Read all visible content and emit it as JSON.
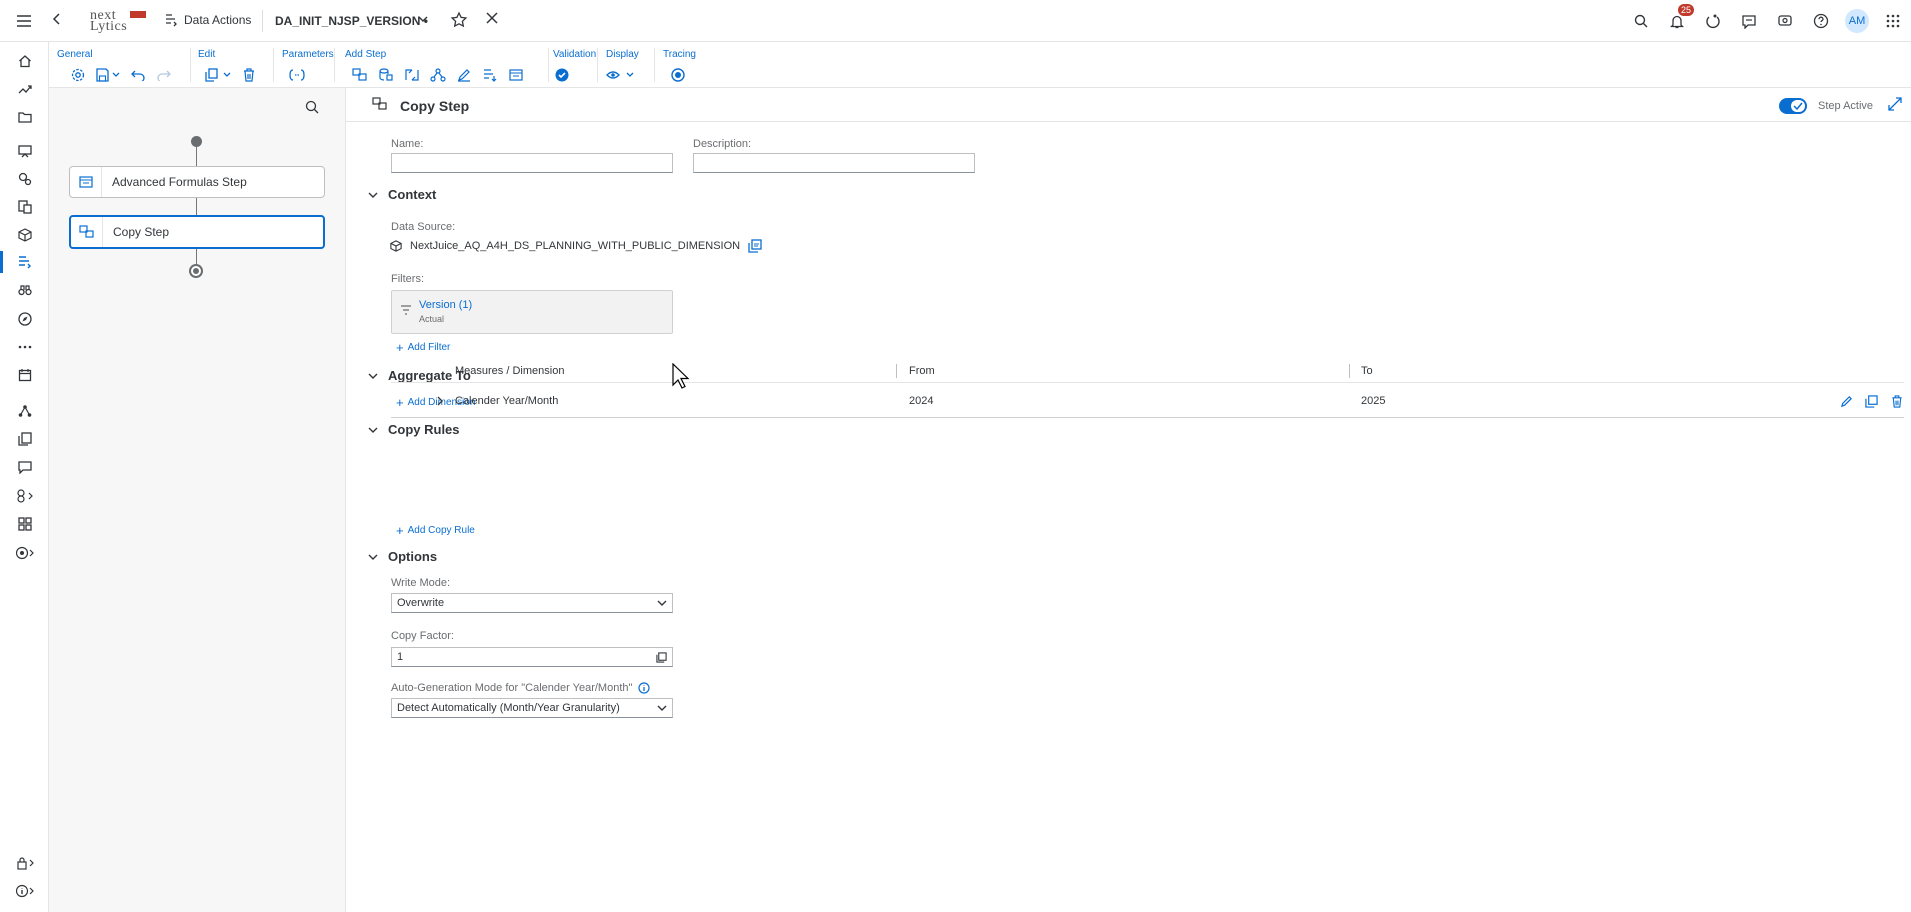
{
  "shell": {
    "logo_line1": "next",
    "logo_line2": "Lytics",
    "breadcrumb": "Data Actions",
    "doc_title": "DA_INIT_NJSP_VERSION",
    "doc_modified": "•",
    "notification_count": "25",
    "avatar_initials": "AM"
  },
  "toolbar": {
    "groups": [
      "General",
      "Edit",
      "Parameters",
      "Add Step",
      "Validation",
      "Display",
      "Tracing"
    ]
  },
  "flow": {
    "steps": [
      "Advanced Formulas Step",
      "Copy Step"
    ]
  },
  "main": {
    "title": "Copy Step",
    "step_active_label": "Step Active",
    "step_active": true,
    "name_label": "Name:",
    "name_value": "",
    "description_label": "Description:",
    "description_value": "",
    "context_title": "Context",
    "data_source_label": "Data Source:",
    "data_source_value": "NextJuice_AQ_A4H_DS_PLANNING_WITH_PUBLIC_DIMENSION",
    "filters_label": "Filters:",
    "filter_name": "Version (1)",
    "filter_value": "Actual",
    "add_filter": "Add Filter",
    "aggregate_title": "Aggregate To",
    "add_dimension": "Add Dimension",
    "copy_rules_title": "Copy Rules",
    "table_headers": [
      "Measures / Dimension",
      "From",
      "To"
    ],
    "rows": [
      {
        "dimension": "Calender Year/Month",
        "from": "2024",
        "to": "2025"
      }
    ],
    "add_copy_rule": "Add Copy Rule",
    "options_title": "Options",
    "write_mode_label": "Write Mode:",
    "write_mode_value": "Overwrite",
    "copy_factor_label": "Copy Factor:",
    "copy_factor_value": "1",
    "auto_gen_label": "Auto-Generation Mode for \"Calender Year/Month\"",
    "auto_gen_value": "Detect Automatically (Month/Year Granularity)"
  },
  "colors": {
    "accent": "#0a6ed1",
    "badge": "#c0392b"
  }
}
